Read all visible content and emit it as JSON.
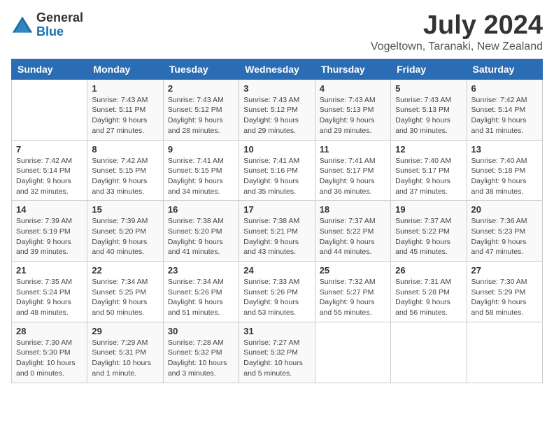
{
  "logo": {
    "general": "General",
    "blue": "Blue"
  },
  "title": {
    "month_year": "July 2024",
    "location": "Vogeltown, Taranaki, New Zealand"
  },
  "weekdays": [
    "Sunday",
    "Monday",
    "Tuesday",
    "Wednesday",
    "Thursday",
    "Friday",
    "Saturday"
  ],
  "weeks": [
    [
      {
        "day": "",
        "info": ""
      },
      {
        "day": "1",
        "info": "Sunrise: 7:43 AM\nSunset: 5:11 PM\nDaylight: 9 hours\nand 27 minutes."
      },
      {
        "day": "2",
        "info": "Sunrise: 7:43 AM\nSunset: 5:12 PM\nDaylight: 9 hours\nand 28 minutes."
      },
      {
        "day": "3",
        "info": "Sunrise: 7:43 AM\nSunset: 5:12 PM\nDaylight: 9 hours\nand 29 minutes."
      },
      {
        "day": "4",
        "info": "Sunrise: 7:43 AM\nSunset: 5:13 PM\nDaylight: 9 hours\nand 29 minutes."
      },
      {
        "day": "5",
        "info": "Sunrise: 7:43 AM\nSunset: 5:13 PM\nDaylight: 9 hours\nand 30 minutes."
      },
      {
        "day": "6",
        "info": "Sunrise: 7:42 AM\nSunset: 5:14 PM\nDaylight: 9 hours\nand 31 minutes."
      }
    ],
    [
      {
        "day": "7",
        "info": "Sunrise: 7:42 AM\nSunset: 5:14 PM\nDaylight: 9 hours\nand 32 minutes."
      },
      {
        "day": "8",
        "info": "Sunrise: 7:42 AM\nSunset: 5:15 PM\nDaylight: 9 hours\nand 33 minutes."
      },
      {
        "day": "9",
        "info": "Sunrise: 7:41 AM\nSunset: 5:15 PM\nDaylight: 9 hours\nand 34 minutes."
      },
      {
        "day": "10",
        "info": "Sunrise: 7:41 AM\nSunset: 5:16 PM\nDaylight: 9 hours\nand 35 minutes."
      },
      {
        "day": "11",
        "info": "Sunrise: 7:41 AM\nSunset: 5:17 PM\nDaylight: 9 hours\nand 36 minutes."
      },
      {
        "day": "12",
        "info": "Sunrise: 7:40 AM\nSunset: 5:17 PM\nDaylight: 9 hours\nand 37 minutes."
      },
      {
        "day": "13",
        "info": "Sunrise: 7:40 AM\nSunset: 5:18 PM\nDaylight: 9 hours\nand 38 minutes."
      }
    ],
    [
      {
        "day": "14",
        "info": "Sunrise: 7:39 AM\nSunset: 5:19 PM\nDaylight: 9 hours\nand 39 minutes."
      },
      {
        "day": "15",
        "info": "Sunrise: 7:39 AM\nSunset: 5:20 PM\nDaylight: 9 hours\nand 40 minutes."
      },
      {
        "day": "16",
        "info": "Sunrise: 7:38 AM\nSunset: 5:20 PM\nDaylight: 9 hours\nand 41 minutes."
      },
      {
        "day": "17",
        "info": "Sunrise: 7:38 AM\nSunset: 5:21 PM\nDaylight: 9 hours\nand 43 minutes."
      },
      {
        "day": "18",
        "info": "Sunrise: 7:37 AM\nSunset: 5:22 PM\nDaylight: 9 hours\nand 44 minutes."
      },
      {
        "day": "19",
        "info": "Sunrise: 7:37 AM\nSunset: 5:22 PM\nDaylight: 9 hours\nand 45 minutes."
      },
      {
        "day": "20",
        "info": "Sunrise: 7:36 AM\nSunset: 5:23 PM\nDaylight: 9 hours\nand 47 minutes."
      }
    ],
    [
      {
        "day": "21",
        "info": "Sunrise: 7:35 AM\nSunset: 5:24 PM\nDaylight: 9 hours\nand 48 minutes."
      },
      {
        "day": "22",
        "info": "Sunrise: 7:34 AM\nSunset: 5:25 PM\nDaylight: 9 hours\nand 50 minutes."
      },
      {
        "day": "23",
        "info": "Sunrise: 7:34 AM\nSunset: 5:26 PM\nDaylight: 9 hours\nand 51 minutes."
      },
      {
        "day": "24",
        "info": "Sunrise: 7:33 AM\nSunset: 5:26 PM\nDaylight: 9 hours\nand 53 minutes."
      },
      {
        "day": "25",
        "info": "Sunrise: 7:32 AM\nSunset: 5:27 PM\nDaylight: 9 hours\nand 55 minutes."
      },
      {
        "day": "26",
        "info": "Sunrise: 7:31 AM\nSunset: 5:28 PM\nDaylight: 9 hours\nand 56 minutes."
      },
      {
        "day": "27",
        "info": "Sunrise: 7:30 AM\nSunset: 5:29 PM\nDaylight: 9 hours\nand 58 minutes."
      }
    ],
    [
      {
        "day": "28",
        "info": "Sunrise: 7:30 AM\nSunset: 5:30 PM\nDaylight: 10 hours\nand 0 minutes."
      },
      {
        "day": "29",
        "info": "Sunrise: 7:29 AM\nSunset: 5:31 PM\nDaylight: 10 hours\nand 1 minute."
      },
      {
        "day": "30",
        "info": "Sunrise: 7:28 AM\nSunset: 5:32 PM\nDaylight: 10 hours\nand 3 minutes."
      },
      {
        "day": "31",
        "info": "Sunrise: 7:27 AM\nSunset: 5:32 PM\nDaylight: 10 hours\nand 5 minutes."
      },
      {
        "day": "",
        "info": ""
      },
      {
        "day": "",
        "info": ""
      },
      {
        "day": "",
        "info": ""
      }
    ]
  ]
}
